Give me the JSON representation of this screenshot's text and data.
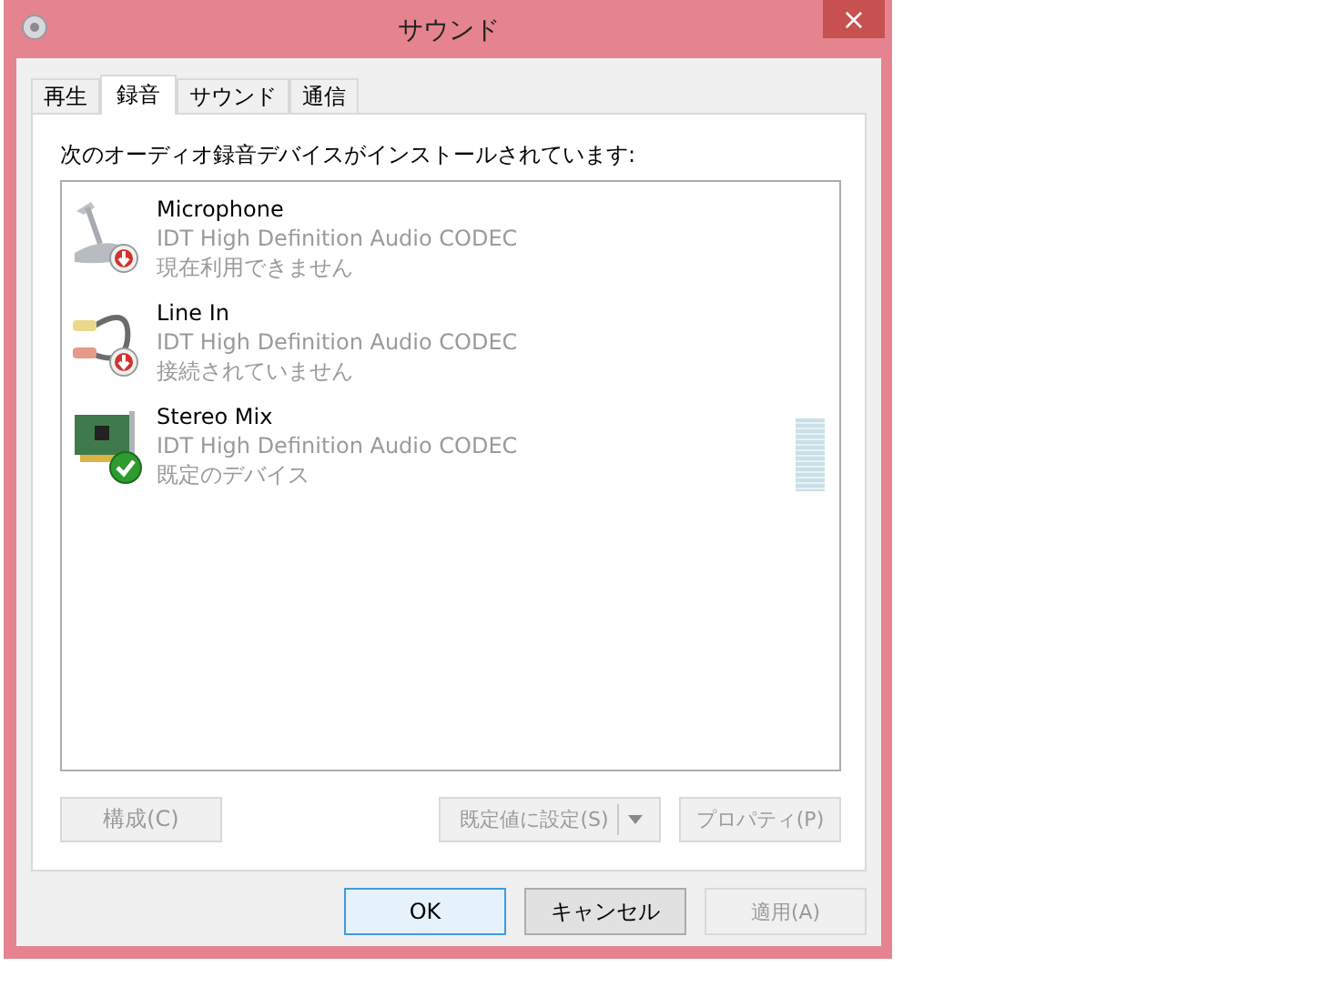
{
  "window": {
    "title": "サウンド",
    "close": "×"
  },
  "tabs": [
    {
      "label": "再生",
      "selected": false
    },
    {
      "label": "録音",
      "selected": true
    },
    {
      "label": "サウンド",
      "selected": false
    },
    {
      "label": "通信",
      "selected": false
    }
  ],
  "instruction": "次のオーディオ録音デバイスがインストールされています:",
  "devices": [
    {
      "kind": "microphone",
      "badge": {
        "kind": "unplugged"
      },
      "name": "Microphone",
      "driver": "IDT High Definition Audio CODEC",
      "state": "現在利用できません",
      "selected": false
    },
    {
      "kind": "line",
      "badge": {
        "kind": "unplugged"
      },
      "name": "Line In",
      "driver": "IDT High Definition Audio CODEC",
      "state": "接続されていません",
      "selected": false
    },
    {
      "kind": "card",
      "badge": {
        "kind": "default"
      },
      "name": "Stereo Mix",
      "driver": "IDT High Definition Audio CODEC",
      "state": "既定のデバイス",
      "selected": false,
      "meter": {
        "level": 0
      }
    }
  ],
  "device_buttons": [
    {
      "label": "構成(C)",
      "disabled": true,
      "split": false
    },
    {
      "label": "既定値に設定(S)",
      "disabled": true,
      "split": true
    },
    {
      "label": "プロパティ(P)",
      "disabled": true,
      "split": false
    }
  ],
  "dialog_buttons": [
    {
      "label": "OK",
      "disabled": false,
      "default": true
    },
    {
      "label": "キャンセル",
      "disabled": false,
      "default": false
    },
    {
      "label": "適用(A)",
      "disabled": true,
      "default": false
    }
  ]
}
